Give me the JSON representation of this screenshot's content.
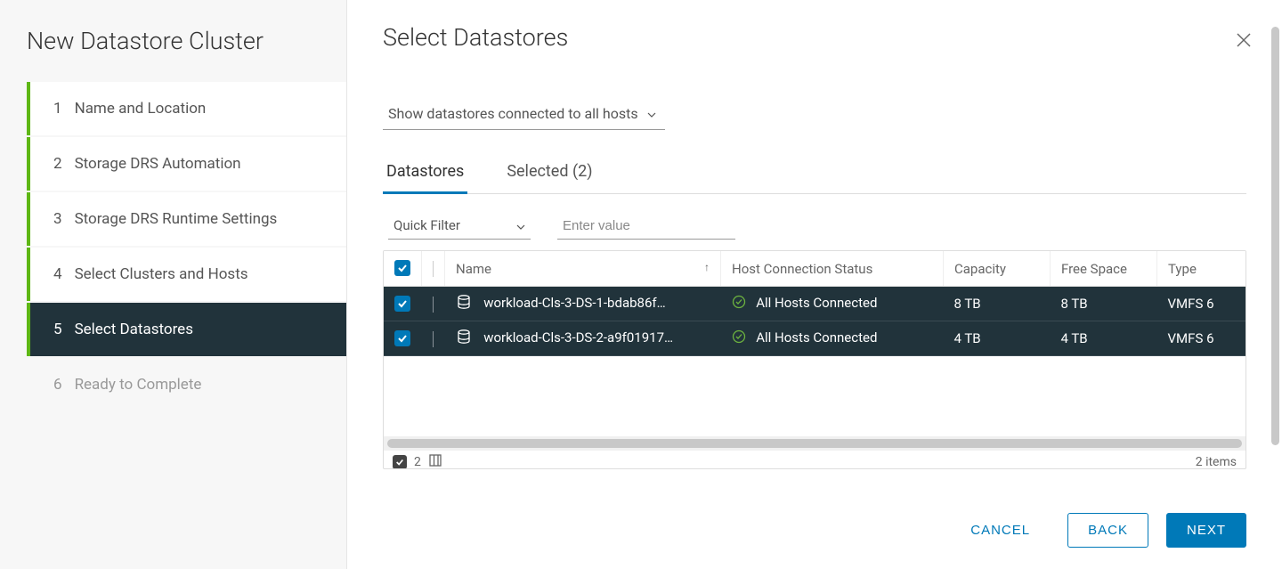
{
  "sidebar": {
    "title": "New Datastore Cluster",
    "steps": [
      {
        "num": "1",
        "label": "Name and Location",
        "state": "completed"
      },
      {
        "num": "2",
        "label": "Storage DRS Automation",
        "state": "completed"
      },
      {
        "num": "3",
        "label": "Storage DRS Runtime Settings",
        "state": "completed"
      },
      {
        "num": "4",
        "label": "Select Clusters and Hosts",
        "state": "completed"
      },
      {
        "num": "5",
        "label": "Select Datastores",
        "state": "active"
      },
      {
        "num": "6",
        "label": "Ready to Complete",
        "state": "future"
      }
    ]
  },
  "main": {
    "title": "Select Datastores",
    "connection_filter": "Show datastores connected to all hosts",
    "tabs": {
      "datastores": "Datastores",
      "selected": "Selected (2)"
    },
    "quick_filter_label": "Quick Filter",
    "filter_placeholder": "Enter value",
    "columns": {
      "name": "Name",
      "host_status": "Host Connection Status",
      "capacity": "Capacity",
      "free_space": "Free Space",
      "type": "Type"
    },
    "rows": [
      {
        "name": "workload-Cls-3-DS-1-bdab86f…",
        "status": "All Hosts Connected",
        "capacity": "8 TB",
        "free": "8 TB",
        "type": "VMFS 6"
      },
      {
        "name": "workload-Cls-3-DS-2-a9f01917…",
        "status": "All Hosts Connected",
        "capacity": "4 TB",
        "free": "4 TB",
        "type": "VMFS 6"
      }
    ],
    "selected_count": "2",
    "items_label": "2 items"
  },
  "footer": {
    "cancel": "CANCEL",
    "back": "BACK",
    "next": "NEXT"
  }
}
